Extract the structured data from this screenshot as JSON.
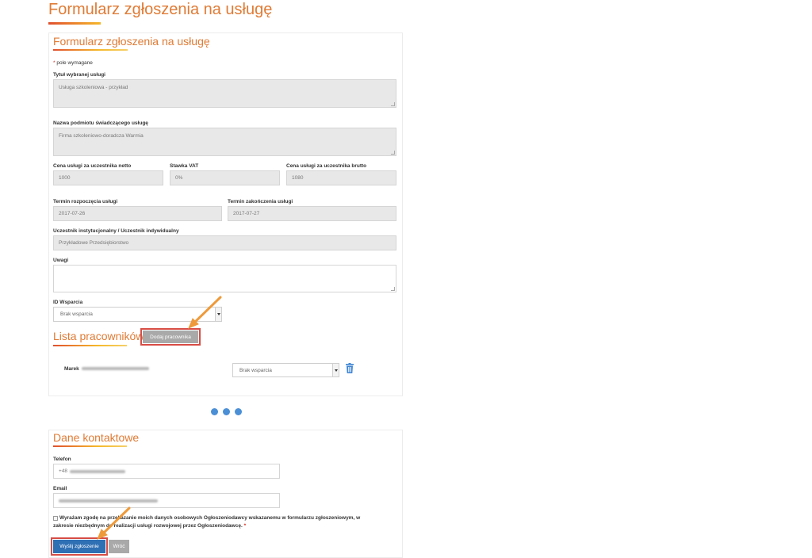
{
  "page": {
    "title": "Formularz zgłoszenia na usługę"
  },
  "form": {
    "title": "Formularz zgłoszenia na usługę",
    "required_note": "pole wymagane",
    "required_mark": "*",
    "service_title": {
      "label": "Tytuł wybranej usługi",
      "value": "Usługa szkoleniowa - przykład"
    },
    "provider": {
      "label": "Nazwa podmiotu świadczącego usługę",
      "value": "Firma szkoleniowo-doradcza Warmia"
    },
    "price_net": {
      "label": "Cena usługi za uczestnika netto",
      "value": "1000"
    },
    "vat_rate": {
      "label": "Stawka VAT",
      "value": "0%"
    },
    "price_gross": {
      "label": "Cena usługi za uczestnika brutto",
      "value": "1080"
    },
    "start_date": {
      "label": "Termin rozpoczęcia usługi",
      "value": "2017-07-26"
    },
    "end_date": {
      "label": "Termin zakończenia usługi",
      "value": "2017-07-27"
    },
    "participant_type": {
      "label": "Uczestnik instytucjonalny / Uczestnik indywidualny",
      "value": "Przykładowe Przedsiębiorstwo"
    },
    "remarks": {
      "label": "Uwagi",
      "value": ""
    },
    "support_id": {
      "label": "ID Wsparcia",
      "selected": "Brak wsparcia"
    }
  },
  "employees": {
    "title": "Lista pracowników",
    "add_button": "Dodaj pracownika",
    "rows": [
      {
        "name": "Marek",
        "support": "Brak wsparcia"
      }
    ]
  },
  "contact": {
    "title": "Dane kontaktowe",
    "phone": {
      "label": "Telefon",
      "prefix": "+48"
    },
    "email": {
      "label": "Email"
    },
    "consent_line1": "Wyrażam zgodę na przekazanie moich danych osobowych Ogłoszeniodawcy wskazanemu w formularzu zgłoszeniowym, w",
    "consent_line2": "zakresie niezbędnym do realizacji usługi rozwojowej przez Ogłoszeniodawcę.",
    "consent_mark": "*",
    "submit_button": "Wyślij zgłoszenie",
    "back_button": "Wróć"
  },
  "colors": {
    "accent": "#e07b35",
    "primary_button": "#2f6fb4",
    "highlight": "#d84d45",
    "arrow": "#ee9a3b",
    "dots": "#4b8fd6"
  },
  "icons": {
    "trash": "trash-icon",
    "arrows": "annotation-arrow-icon",
    "pagination": "pagination-dots-icon"
  }
}
